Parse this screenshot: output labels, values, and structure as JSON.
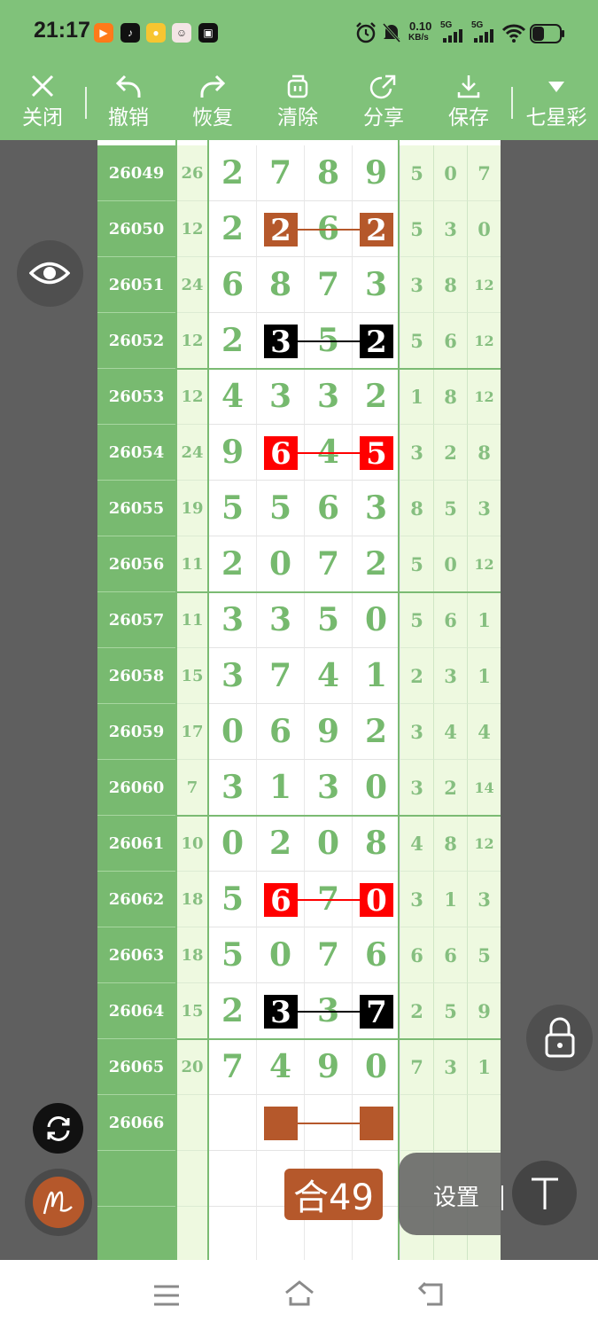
{
  "status_bar": {
    "time": "21:17",
    "network_speed": "0.10",
    "network_unit": "KB/s",
    "sim1": "5G",
    "sim2": "5G",
    "icons": [
      "taobao-app-icon",
      "tiktok-app-icon",
      "yellow-app-icon",
      "avatar-app-icon",
      "bilibili-app-icon",
      "alarm-icon",
      "mute-icon",
      "signal-icon",
      "signal-icon",
      "wifi-icon",
      "battery-icon"
    ]
  },
  "toolbar": {
    "close": "关闭",
    "undo": "撤销",
    "redo": "恢复",
    "clear": "清除",
    "share": "分享",
    "save": "保存",
    "lottery": "七星彩"
  },
  "colors": {
    "header_green": "#80c27a",
    "digit_green": "#76b96e",
    "brown": "#b5582b",
    "red": "#ff0000",
    "black": "#000000"
  },
  "rows": [
    {
      "id": "26049",
      "sum": "26",
      "d": [
        "2",
        "7",
        "8",
        "9"
      ],
      "r": [
        "5",
        "0",
        "7"
      ]
    },
    {
      "id": "26050",
      "sum": "12",
      "d": [
        "2",
        "2",
        "6",
        "2"
      ],
      "r": [
        "5",
        "3",
        "0"
      ]
    },
    {
      "id": "26051",
      "sum": "24",
      "d": [
        "6",
        "8",
        "7",
        "3"
      ],
      "r": [
        "3",
        "8",
        "12"
      ]
    },
    {
      "id": "26052",
      "sum": "12",
      "d": [
        "2",
        "3",
        "5",
        "2"
      ],
      "r": [
        "5",
        "6",
        "12"
      ]
    },
    {
      "id": "26053",
      "sum": "12",
      "d": [
        "4",
        "3",
        "3",
        "2"
      ],
      "r": [
        "1",
        "8",
        "12"
      ]
    },
    {
      "id": "26054",
      "sum": "24",
      "d": [
        "9",
        "6",
        "4",
        "5"
      ],
      "r": [
        "3",
        "2",
        "8"
      ]
    },
    {
      "id": "26055",
      "sum": "19",
      "d": [
        "5",
        "5",
        "6",
        "3"
      ],
      "r": [
        "8",
        "5",
        "3"
      ]
    },
    {
      "id": "26056",
      "sum": "11",
      "d": [
        "2",
        "0",
        "7",
        "2"
      ],
      "r": [
        "5",
        "0",
        "12"
      ]
    },
    {
      "id": "26057",
      "sum": "11",
      "d": [
        "3",
        "3",
        "5",
        "0"
      ],
      "r": [
        "5",
        "6",
        "1"
      ]
    },
    {
      "id": "26058",
      "sum": "15",
      "d": [
        "3",
        "7",
        "4",
        "1"
      ],
      "r": [
        "2",
        "3",
        "1"
      ]
    },
    {
      "id": "26059",
      "sum": "17",
      "d": [
        "0",
        "6",
        "9",
        "2"
      ],
      "r": [
        "3",
        "4",
        "4"
      ]
    },
    {
      "id": "26060",
      "sum": "7",
      "d": [
        "3",
        "1",
        "3",
        "0"
      ],
      "r": [
        "3",
        "2",
        "14"
      ]
    },
    {
      "id": "26061",
      "sum": "10",
      "d": [
        "0",
        "2",
        "0",
        "8"
      ],
      "r": [
        "4",
        "8",
        "12"
      ]
    },
    {
      "id": "26062",
      "sum": "18",
      "d": [
        "5",
        "6",
        "7",
        "0"
      ],
      "r": [
        "3",
        "1",
        "3"
      ]
    },
    {
      "id": "26063",
      "sum": "18",
      "d": [
        "5",
        "0",
        "7",
        "6"
      ],
      "r": [
        "6",
        "6",
        "5"
      ]
    },
    {
      "id": "26064",
      "sum": "15",
      "d": [
        "2",
        "3",
        "3",
        "7"
      ],
      "r": [
        "2",
        "5",
        "9"
      ]
    },
    {
      "id": "26065",
      "sum": "20",
      "d": [
        "7",
        "4",
        "9",
        "0"
      ],
      "r": [
        "7",
        "3",
        "1"
      ]
    },
    {
      "id": "26066",
      "sum": "",
      "d": [
        "",
        "",
        "",
        ""
      ],
      "r": [
        "",
        "",
        ""
      ]
    },
    {
      "id": "",
      "sum": "",
      "d": [
        "",
        "",
        "",
        ""
      ],
      "r": [
        "",
        "",
        ""
      ]
    },
    {
      "id": "",
      "sum": "",
      "d": [
        "",
        "",
        "",
        ""
      ],
      "r": [
        "",
        "",
        ""
      ]
    }
  ],
  "annotations": [
    {
      "row": 1,
      "color": "#b5582b"
    },
    {
      "row": 3,
      "color": "#000000"
    },
    {
      "row": 5,
      "color": "#ff0000"
    },
    {
      "row": 13,
      "color": "#ff0000"
    },
    {
      "row": 15,
      "color": "#000000"
    },
    {
      "row": 17,
      "color": "#b5582b"
    }
  ],
  "total_label": "合49",
  "settings": {
    "label": "设置",
    "text_tool": "T"
  },
  "nav": {
    "icons": [
      "menu-icon",
      "home-icon",
      "back-icon"
    ]
  }
}
